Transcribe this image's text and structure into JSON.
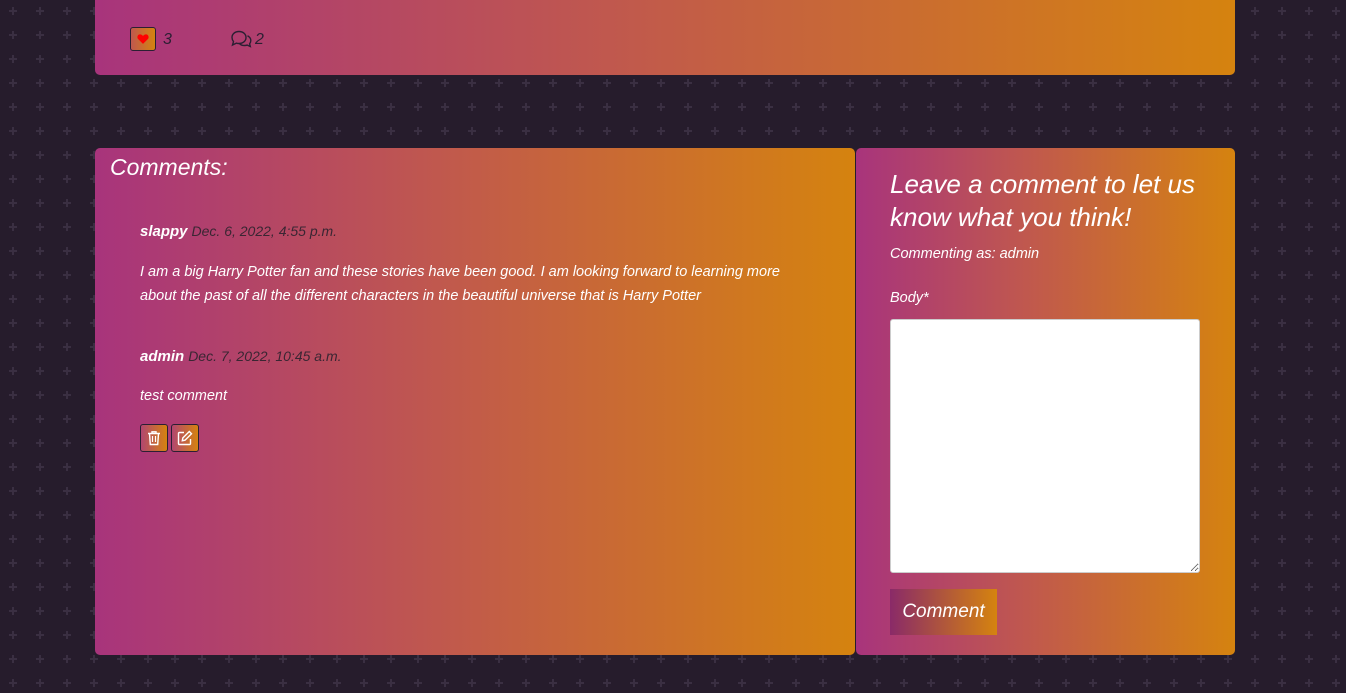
{
  "post_stats": {
    "likes": "3",
    "comments": "2"
  },
  "comments_section": {
    "heading": "Comments:",
    "items": [
      {
        "author": "slappy",
        "date": "Dec. 6, 2022, 4:55 p.m.",
        "body": "I am a big Harry Potter fan and these stories have been good. I am looking forward to learning more about the past of all the different characters in the beautiful universe that is Harry Potter"
      },
      {
        "author": "admin",
        "date": "Dec. 7, 2022, 10:45 a.m.",
        "body": "test comment"
      }
    ]
  },
  "comment_form": {
    "heading": "Leave a comment to let us know what you think!",
    "commenting_as": "Commenting as: admin",
    "body_label": "Body*",
    "body_value": "",
    "submit_label": "Comment"
  },
  "icons": {
    "like": "heart-icon",
    "comments": "speech-bubbles-icon",
    "delete": "trash-icon",
    "edit": "edit-icon"
  },
  "colors": {
    "background": "#261c2c",
    "gradient_start": "#a8347c",
    "gradient_end": "#d5830f",
    "like_heart": "#ff0000"
  }
}
